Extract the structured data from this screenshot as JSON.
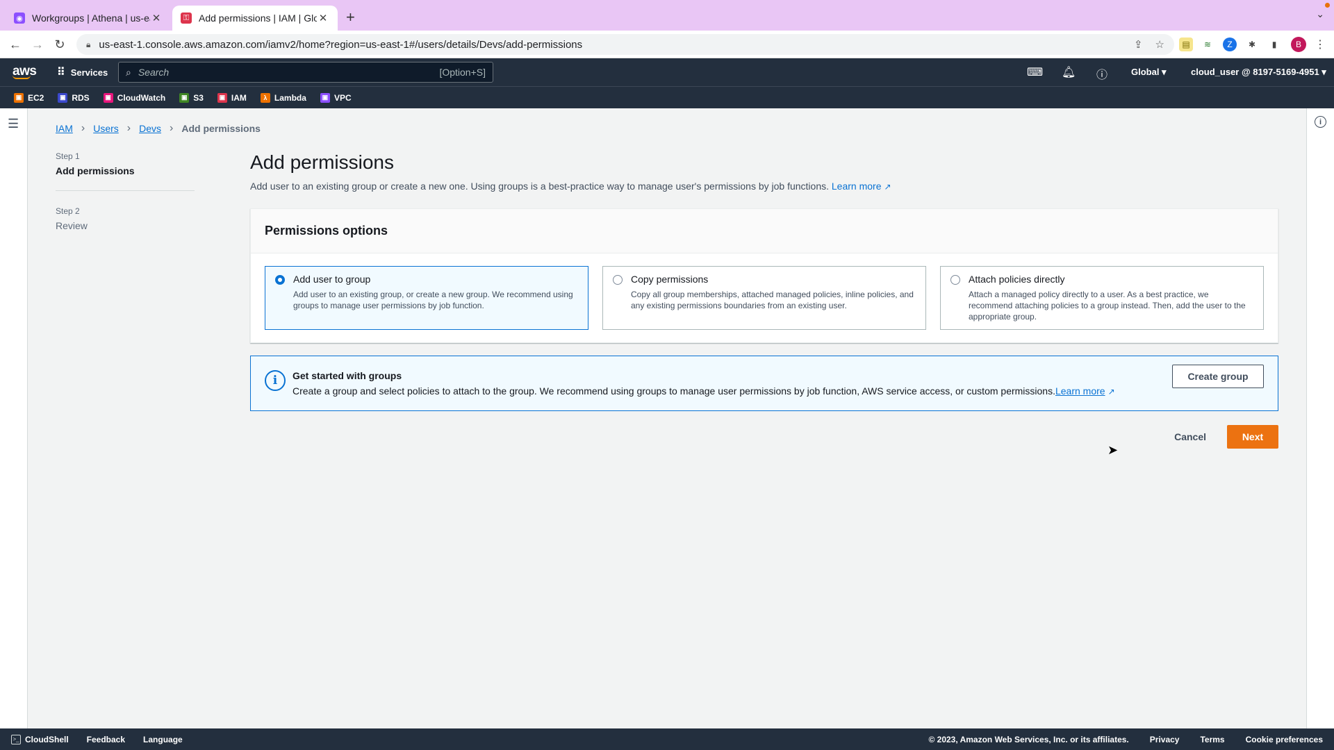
{
  "browser": {
    "tabs": [
      {
        "title": "Workgroups | Athena | us-east",
        "active": false,
        "favicon_color": "#8c4fff"
      },
      {
        "title": "Add permissions | IAM | Global",
        "active": true,
        "favicon_color": "#dd344c"
      }
    ],
    "url": "us-east-1.console.aws.amazon.com/iamv2/home?region=us-east-1#/users/details/Devs/add-permissions",
    "profile_initial": "B"
  },
  "aws_nav": {
    "logo": "aws",
    "services_label": "Services",
    "search_placeholder": "Search",
    "search_shortcut": "[Option+S]",
    "region": "Global ▾",
    "account": "cloud_user @ 8197-5169-4951 ▾"
  },
  "favorites": [
    {
      "label": "EC2",
      "color": "#ed7100"
    },
    {
      "label": "RDS",
      "color": "#3b48cc"
    },
    {
      "label": "CloudWatch",
      "color": "#e7157b"
    },
    {
      "label": "S3",
      "color": "#3f8624"
    },
    {
      "label": "IAM",
      "color": "#dd344c"
    },
    {
      "label": "Lambda",
      "color": "#ed7100"
    },
    {
      "label": "VPC",
      "color": "#8c4fff"
    }
  ],
  "breadcrumb": {
    "items": [
      "IAM",
      "Users",
      "Devs"
    ],
    "current": "Add permissions"
  },
  "wizard": {
    "steps": [
      {
        "number": "Step 1",
        "title": "Add permissions",
        "active": true
      },
      {
        "number": "Step 2",
        "title": "Review",
        "active": false
      }
    ]
  },
  "page": {
    "title": "Add permissions",
    "description": "Add user to an existing group or create a new one. Using groups is a best-practice way to manage user's permissions by job functions.",
    "learn_more": "Learn more"
  },
  "permissions_panel": {
    "header": "Permissions options",
    "options": [
      {
        "label": "Add user to group",
        "description": "Add user to an existing group, or create a new group. We recommend using groups to manage user permissions by job function.",
        "selected": true
      },
      {
        "label": "Copy permissions",
        "description": "Copy all group memberships, attached managed policies, inline policies, and any existing permissions boundaries from an existing user.",
        "selected": false
      },
      {
        "label": "Attach policies directly",
        "description": "Attach a managed policy directly to a user. As a best practice, we recommend attaching policies to a group instead. Then, add the user to the appropriate group.",
        "selected": false
      }
    ]
  },
  "info_flash": {
    "title": "Get started with groups",
    "body": "Create a group and select policies to attach to the group. We recommend using groups to manage user permissions by job function, AWS service access, or custom permissions.",
    "learn_more": "Learn more",
    "button": "Create group"
  },
  "actions": {
    "cancel": "Cancel",
    "next": "Next"
  },
  "footer": {
    "cloudshell": "CloudShell",
    "feedback": "Feedback",
    "language": "Language",
    "copyright": "© 2023, Amazon Web Services, Inc. or its affiliates.",
    "privacy": "Privacy",
    "terms": "Terms",
    "cookies": "Cookie preferences"
  },
  "colors": {
    "accent": "#0972d3",
    "primary_button": "#ec7211",
    "nav_bg": "#232f3e"
  }
}
